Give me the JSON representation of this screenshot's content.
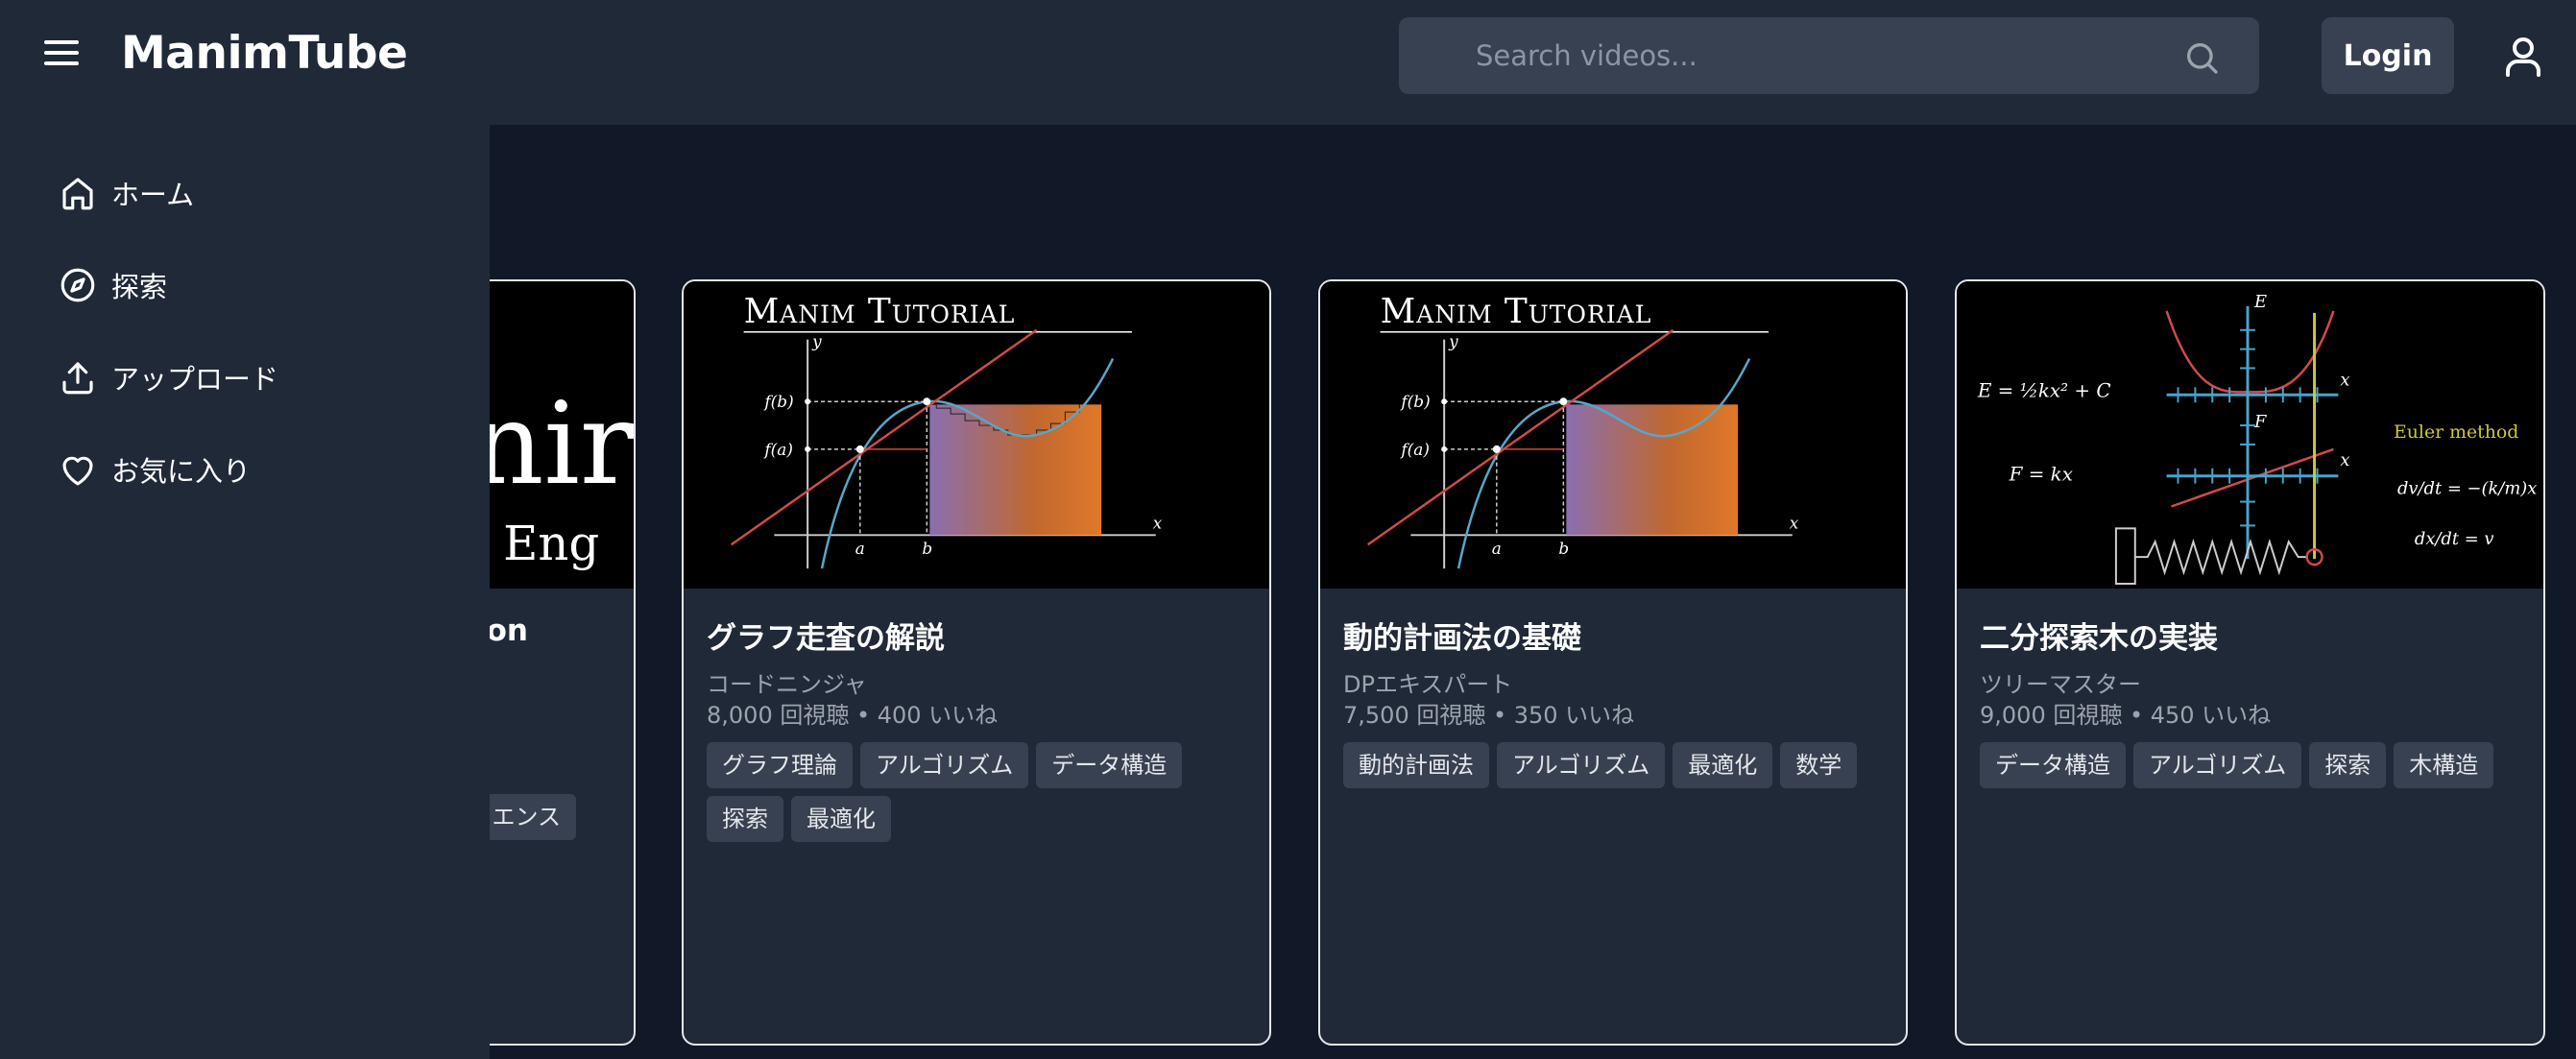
{
  "header": {
    "logo": "ManimTube",
    "search_placeholder": "Search videos...",
    "login_label": "Login"
  },
  "sidebar": {
    "items": [
      {
        "label": "ホーム",
        "icon": "home-icon"
      },
      {
        "label": "探索",
        "icon": "compass-icon"
      },
      {
        "label": "アップロード",
        "icon": "upload-icon"
      },
      {
        "label": "お気に入り",
        "icon": "heart-icon"
      }
    ]
  },
  "cards": [
    {
      "thumbnail_text_1": "anir",
      "thumbnail_text_2": "on Eng",
      "title": "ion",
      "tags": [
        "エンス"
      ]
    },
    {
      "thumbnail_title": "Manim Tutorial",
      "title": "グラフ走査の解説",
      "author": "コードニンジャ",
      "stats": "8,000 回視聴 • 400 いいね",
      "tags": [
        "グラフ理論",
        "アルゴリズム",
        "データ構造",
        "探索",
        "最適化"
      ]
    },
    {
      "thumbnail_title": "Manim Tutorial",
      "title": "動的計画法の基礎",
      "author": "DPエキスパート",
      "stats": "7,500 回視聴 • 350 いいね",
      "tags": [
        "動的計画法",
        "アルゴリズム",
        "最適化",
        "数学"
      ]
    },
    {
      "title": "二分探索木の実装",
      "author": "ツリーマスター",
      "stats": "9,000 回視聴 • 450 いいね",
      "tags": [
        "データ構造",
        "アルゴリズム",
        "探索",
        "木構造"
      ],
      "thumbnail_labels": {
        "energy": "E = ½kx² + C",
        "force": "F = kx",
        "euler": "Euler method",
        "eq1": "dv/dt = −(k/m)x",
        "eq2": "dx/dt = v",
        "axis_e": "E",
        "axis_f": "F",
        "axis_x": "x"
      }
    }
  ]
}
